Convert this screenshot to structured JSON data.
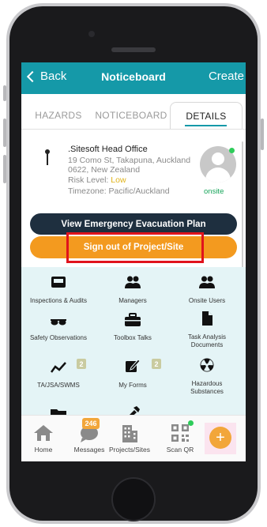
{
  "nav": {
    "back_label": "Back",
    "title": "Noticeboard",
    "create_label": "Create"
  },
  "tabs": [
    {
      "label": "HAZARDS"
    },
    {
      "label": "NOTICEBOARD"
    },
    {
      "label": "DETAILS",
      "active": true
    }
  ],
  "site": {
    "name": ".Sitesoft Head Office",
    "address_line1": "19 Como St, Takapuna, Auckland",
    "address_line2": "0622, New Zealand",
    "risk_prefix": "Risk Level: ",
    "risk_value": "Low",
    "timezone": "Timezone: Pacific/Auckland",
    "status": "onsite"
  },
  "buttons": {
    "evacuation": "View Emergency Evacuation Plan",
    "sign_out": "Sign out of Project/Site"
  },
  "grid": [
    {
      "label": "Inspections & Audits",
      "icon": "inbox-icon"
    },
    {
      "label": "Managers",
      "icon": "users-icon"
    },
    {
      "label": "Onsite Users",
      "icon": "users-icon"
    },
    {
      "label": "Safety Observations",
      "icon": "glasses-icon"
    },
    {
      "label": "Toolbox Talks",
      "icon": "toolbox-icon"
    },
    {
      "label": "Task Analysis Documents",
      "icon": "document-icon"
    },
    {
      "label": "TA/JSA/SWMS",
      "icon": "chart-line-icon",
      "badge": "2"
    },
    {
      "label": "My Forms",
      "icon": "form-edit-icon",
      "badge": "2"
    },
    {
      "label": "Hazardous Substances",
      "icon": "radiation-icon"
    }
  ],
  "bottom_nav": [
    {
      "label": "Home",
      "icon": "home-icon"
    },
    {
      "label": "Messages",
      "icon": "chat-icon",
      "badge": "246"
    },
    {
      "label": "Projects/Sites",
      "icon": "building-icon"
    },
    {
      "label": "Scan QR",
      "icon": "qr-code-icon"
    }
  ],
  "colors": {
    "nav_teal": "#1599a8",
    "evac_navy": "#1e2f3f",
    "signout_orange": "#f39a1f",
    "highlight_red": "#e0131c",
    "grid_bg": "#e4f4f6",
    "risk_low": "#e0b31a",
    "onsite_green": "#17a55a"
  }
}
